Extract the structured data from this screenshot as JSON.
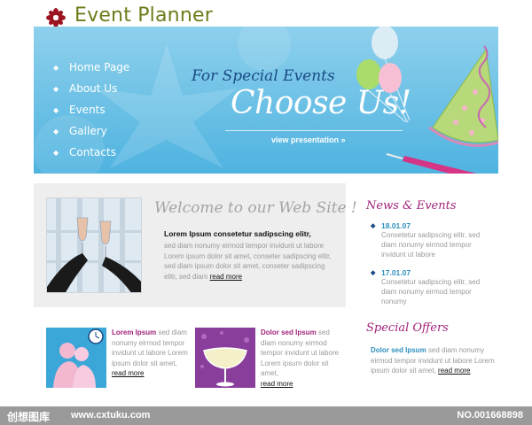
{
  "header": {
    "title": "Event Planner",
    "logo_icon": "flower-icon"
  },
  "banner": {
    "nav": [
      {
        "label": "Home Page"
      },
      {
        "label": "About Us"
      },
      {
        "label": "Events"
      },
      {
        "label": "Gallery"
      },
      {
        "label": "Contacts"
      }
    ],
    "tagline_small": "For Special Events",
    "tagline_big": "Choose Us!",
    "view_presentation": "view presentation »"
  },
  "welcome": {
    "title": "Welcome to our Web Site !",
    "heading": "Lorem Ipsum consetetur sadipscing elitr,",
    "body": "sed diam nonumy eirmod tempor invidunt ut labore Lorem ipsum dolor sit amet, conseter sadipscing elitr, sed diam ipsum dolor sit amet, conseter sadipscing elitr, sed diam",
    "read_more": "read more"
  },
  "features": [
    {
      "title": "Lorem Ipsum",
      "text": "sed diam nonumy eirmod tempor invidunt ut labore Lorem ipsum dolor sit amet,",
      "read_more": "read more"
    },
    {
      "title": "Dolor sed Ipsum",
      "text": "sed diam nonumy eirmod tempor invidunt ut labore Lorem ipsum dolor sit amet,",
      "read_more": "read more"
    }
  ],
  "news": {
    "heading": "News & Events",
    "items": [
      {
        "date": "18.01.07",
        "text": "Consetetur sadipscing elitr, sed diam nonumy eirmod tempor invidunt ut labore"
      },
      {
        "date": "17.01.07",
        "text": "Consetetur sadipscing elitr, sed diam nonumy eirmod tempor nonumy"
      }
    ]
  },
  "offers": {
    "heading": "Special Offers",
    "title": "Dolor sed Ipsum",
    "text": "sed diam nonumy eirmod tempor invidunt ut labore Lorem ipsum dolor sit amet,",
    "read_more": "read more"
  },
  "footer": {
    "cn_text": "创想图库",
    "url": "www.cxtuku.com",
    "number": "NO.001668898"
  },
  "colors": {
    "title_green": "#6b7d1a",
    "banner_blue": "#4fb3e0",
    "accent_magenta": "#a0237a",
    "date_blue": "#2e8fbd"
  }
}
